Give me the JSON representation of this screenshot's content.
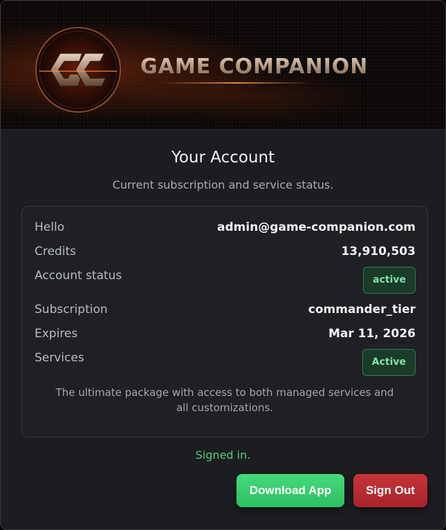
{
  "brand": {
    "name": "GAME COMPANION",
    "logo_letters": "GC"
  },
  "header": {
    "title": "Your Account",
    "subtitle": "Current subscription and service status."
  },
  "account": {
    "hello": {
      "label": "Hello",
      "value": "admin@game-companion.com"
    },
    "credits": {
      "label": "Credits",
      "value": "13,910,503"
    },
    "status": {
      "label": "Account status",
      "value": "active"
    },
    "subscription": {
      "label": "Subscription",
      "value": "commander_tier"
    },
    "expires": {
      "label": "Expires",
      "value": "Mar 11, 2026"
    },
    "services": {
      "label": "Services",
      "value": "Active"
    },
    "description": "The ultimate package with access to both managed services and all customizations."
  },
  "status_message": "Signed in.",
  "actions": {
    "download_label": "Download App",
    "signout_label": "Sign Out"
  },
  "colors": {
    "success": "#4fcf74",
    "download_button": "#3ccd70",
    "signout_button": "#b8292f",
    "badge_bg": "#1b3b29",
    "badge_text": "#7ee2a2"
  }
}
